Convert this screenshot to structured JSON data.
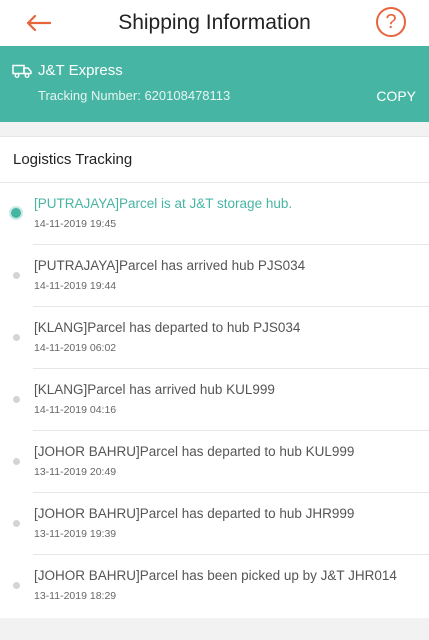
{
  "header": {
    "title": "Shipping Information",
    "help_label": "?"
  },
  "shipment": {
    "carrier": "J&T Express",
    "tracking_label": "Tracking Number:",
    "tracking_number": "620108478113",
    "copy_label": "COPY"
  },
  "logistics": {
    "title": "Logistics Tracking",
    "events": [
      {
        "text": "[PUTRAJAYA]Parcel is at J&T storage hub.",
        "time": "14-11-2019 19:45",
        "active": true
      },
      {
        "text": "[PUTRAJAYA]Parcel has arrived hub PJS034",
        "time": "14-11-2019 19:44",
        "active": false
      },
      {
        "text": "[KLANG]Parcel has departed to hub PJS034",
        "time": "14-11-2019 06:02",
        "active": false
      },
      {
        "text": "[KLANG]Parcel has arrived hub KUL999",
        "time": "14-11-2019 04:16",
        "active": false
      },
      {
        "text": "[JOHOR BAHRU]Parcel has departed to hub KUL999",
        "time": "13-11-2019 20:49",
        "active": false
      },
      {
        "text": "[JOHOR BAHRU]Parcel has departed to hub JHR999",
        "time": "13-11-2019 19:39",
        "active": false
      },
      {
        "text": "[JOHOR BAHRU]Parcel has been picked up by J&T JHR014",
        "time": "13-11-2019 18:29",
        "active": false
      }
    ]
  },
  "colors": {
    "accent": "#47b5a4",
    "back_arrow": "#e8643c"
  }
}
